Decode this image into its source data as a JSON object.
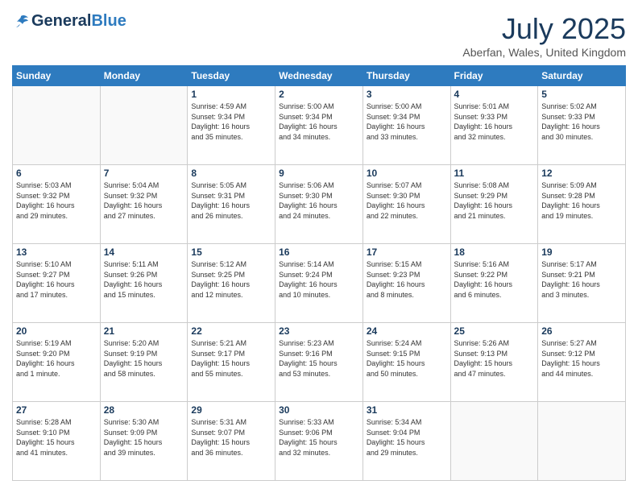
{
  "header": {
    "logo_general": "General",
    "logo_blue": "Blue",
    "month": "July 2025",
    "location": "Aberfan, Wales, United Kingdom"
  },
  "weekdays": [
    "Sunday",
    "Monday",
    "Tuesday",
    "Wednesday",
    "Thursday",
    "Friday",
    "Saturday"
  ],
  "weeks": [
    [
      {
        "day": "",
        "info": ""
      },
      {
        "day": "",
        "info": ""
      },
      {
        "day": "1",
        "info": "Sunrise: 4:59 AM\nSunset: 9:34 PM\nDaylight: 16 hours\nand 35 minutes."
      },
      {
        "day": "2",
        "info": "Sunrise: 5:00 AM\nSunset: 9:34 PM\nDaylight: 16 hours\nand 34 minutes."
      },
      {
        "day": "3",
        "info": "Sunrise: 5:00 AM\nSunset: 9:34 PM\nDaylight: 16 hours\nand 33 minutes."
      },
      {
        "day": "4",
        "info": "Sunrise: 5:01 AM\nSunset: 9:33 PM\nDaylight: 16 hours\nand 32 minutes."
      },
      {
        "day": "5",
        "info": "Sunrise: 5:02 AM\nSunset: 9:33 PM\nDaylight: 16 hours\nand 30 minutes."
      }
    ],
    [
      {
        "day": "6",
        "info": "Sunrise: 5:03 AM\nSunset: 9:32 PM\nDaylight: 16 hours\nand 29 minutes."
      },
      {
        "day": "7",
        "info": "Sunrise: 5:04 AM\nSunset: 9:32 PM\nDaylight: 16 hours\nand 27 minutes."
      },
      {
        "day": "8",
        "info": "Sunrise: 5:05 AM\nSunset: 9:31 PM\nDaylight: 16 hours\nand 26 minutes."
      },
      {
        "day": "9",
        "info": "Sunrise: 5:06 AM\nSunset: 9:30 PM\nDaylight: 16 hours\nand 24 minutes."
      },
      {
        "day": "10",
        "info": "Sunrise: 5:07 AM\nSunset: 9:30 PM\nDaylight: 16 hours\nand 22 minutes."
      },
      {
        "day": "11",
        "info": "Sunrise: 5:08 AM\nSunset: 9:29 PM\nDaylight: 16 hours\nand 21 minutes."
      },
      {
        "day": "12",
        "info": "Sunrise: 5:09 AM\nSunset: 9:28 PM\nDaylight: 16 hours\nand 19 minutes."
      }
    ],
    [
      {
        "day": "13",
        "info": "Sunrise: 5:10 AM\nSunset: 9:27 PM\nDaylight: 16 hours\nand 17 minutes."
      },
      {
        "day": "14",
        "info": "Sunrise: 5:11 AM\nSunset: 9:26 PM\nDaylight: 16 hours\nand 15 minutes."
      },
      {
        "day": "15",
        "info": "Sunrise: 5:12 AM\nSunset: 9:25 PM\nDaylight: 16 hours\nand 12 minutes."
      },
      {
        "day": "16",
        "info": "Sunrise: 5:14 AM\nSunset: 9:24 PM\nDaylight: 16 hours\nand 10 minutes."
      },
      {
        "day": "17",
        "info": "Sunrise: 5:15 AM\nSunset: 9:23 PM\nDaylight: 16 hours\nand 8 minutes."
      },
      {
        "day": "18",
        "info": "Sunrise: 5:16 AM\nSunset: 9:22 PM\nDaylight: 16 hours\nand 6 minutes."
      },
      {
        "day": "19",
        "info": "Sunrise: 5:17 AM\nSunset: 9:21 PM\nDaylight: 16 hours\nand 3 minutes."
      }
    ],
    [
      {
        "day": "20",
        "info": "Sunrise: 5:19 AM\nSunset: 9:20 PM\nDaylight: 16 hours\nand 1 minute."
      },
      {
        "day": "21",
        "info": "Sunrise: 5:20 AM\nSunset: 9:19 PM\nDaylight: 15 hours\nand 58 minutes."
      },
      {
        "day": "22",
        "info": "Sunrise: 5:21 AM\nSunset: 9:17 PM\nDaylight: 15 hours\nand 55 minutes."
      },
      {
        "day": "23",
        "info": "Sunrise: 5:23 AM\nSunset: 9:16 PM\nDaylight: 15 hours\nand 53 minutes."
      },
      {
        "day": "24",
        "info": "Sunrise: 5:24 AM\nSunset: 9:15 PM\nDaylight: 15 hours\nand 50 minutes."
      },
      {
        "day": "25",
        "info": "Sunrise: 5:26 AM\nSunset: 9:13 PM\nDaylight: 15 hours\nand 47 minutes."
      },
      {
        "day": "26",
        "info": "Sunrise: 5:27 AM\nSunset: 9:12 PM\nDaylight: 15 hours\nand 44 minutes."
      }
    ],
    [
      {
        "day": "27",
        "info": "Sunrise: 5:28 AM\nSunset: 9:10 PM\nDaylight: 15 hours\nand 41 minutes."
      },
      {
        "day": "28",
        "info": "Sunrise: 5:30 AM\nSunset: 9:09 PM\nDaylight: 15 hours\nand 39 minutes."
      },
      {
        "day": "29",
        "info": "Sunrise: 5:31 AM\nSunset: 9:07 PM\nDaylight: 15 hours\nand 36 minutes."
      },
      {
        "day": "30",
        "info": "Sunrise: 5:33 AM\nSunset: 9:06 PM\nDaylight: 15 hours\nand 32 minutes."
      },
      {
        "day": "31",
        "info": "Sunrise: 5:34 AM\nSunset: 9:04 PM\nDaylight: 15 hours\nand 29 minutes."
      },
      {
        "day": "",
        "info": ""
      },
      {
        "day": "",
        "info": ""
      }
    ]
  ]
}
